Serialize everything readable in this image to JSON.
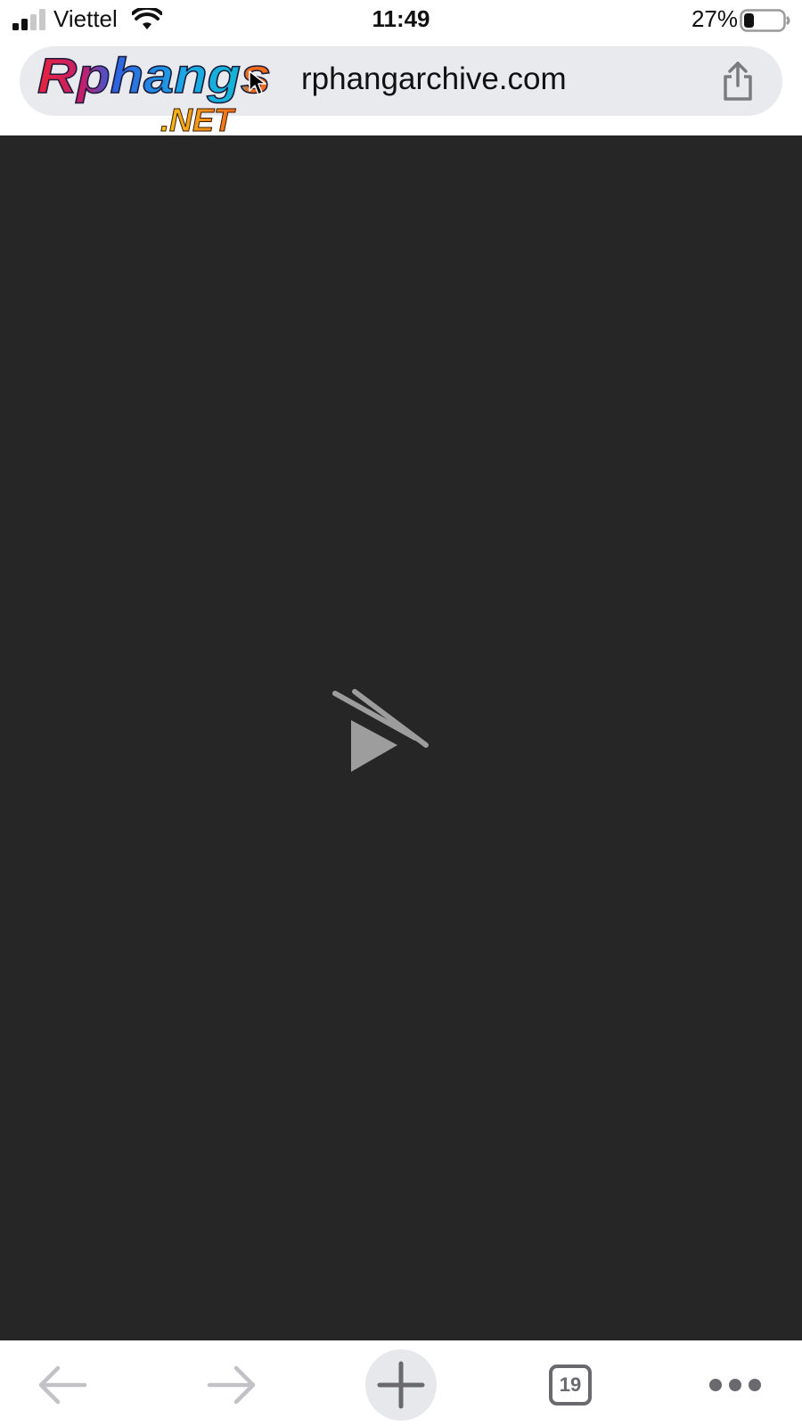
{
  "status_bar": {
    "carrier": "Viettel",
    "time": "11:49",
    "battery_percent": "27%",
    "battery_level": 0.27,
    "signal_bars_active": 2,
    "signal_bars_total": 4
  },
  "address_bar": {
    "url": "rphangarchive.com"
  },
  "logo": {
    "wordmark": "Rphangs",
    "suffix": ".NET"
  },
  "toolbar": {
    "tab_count": "19"
  },
  "colors": {
    "content_background": "#262626",
    "address_bar_background": "#e9eaee",
    "icon_gray": "#6a6a6e",
    "disabled_gray": "#c2c2c6"
  },
  "icons": {
    "back": "arrow-left-icon",
    "forward": "arrow-right-icon",
    "new_tab": "plus-icon",
    "tabs": "tab-switcher-icon",
    "more": "ellipsis-icon",
    "share": "share-icon",
    "video": "video-unavailable-icon"
  }
}
